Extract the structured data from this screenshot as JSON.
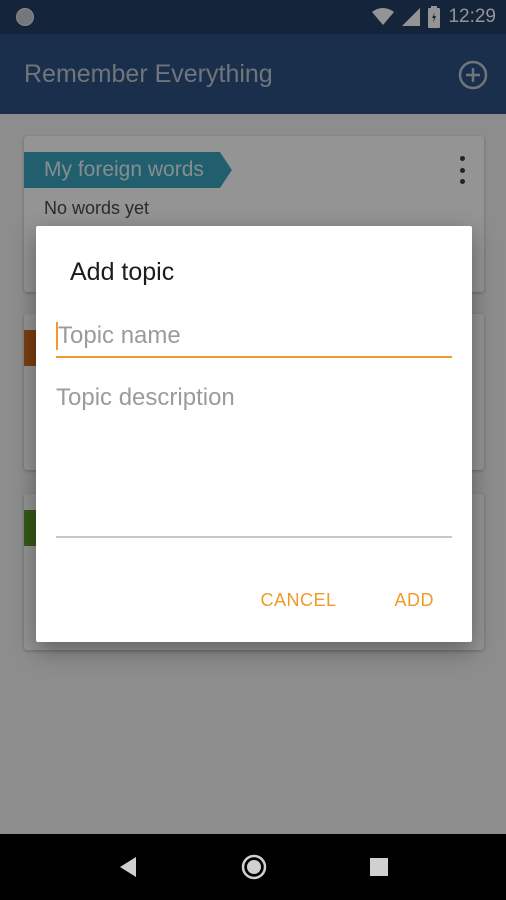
{
  "status_bar": {
    "time": "12:29",
    "icons": [
      "notification-dot-icon",
      "wifi-icon",
      "signal-icon",
      "battery-icon"
    ]
  },
  "app_bar": {
    "title": "Remember Everything",
    "add_icon": "add-circle-icon"
  },
  "cards": [
    {
      "tag": "My foreign words",
      "subtitle": "No words yet",
      "tag_color": "#3aa4bf"
    },
    {
      "tag": "",
      "subtitle": "",
      "tag_color": "#d2691e"
    },
    {
      "tag": "",
      "subtitle": "",
      "tag_color": "#5a9a2a"
    }
  ],
  "dialog": {
    "title": "Add topic",
    "topic_name_placeholder": "Topic name",
    "topic_name_value": "",
    "topic_description_placeholder": "Topic description",
    "topic_description_value": "",
    "cancel_label": "CANCEL",
    "add_label": "ADD"
  },
  "nav_bar": {
    "icons": [
      "back-icon",
      "home-icon",
      "recents-icon"
    ]
  },
  "colors": {
    "status_bar": "#223e66",
    "app_bar": "#2e5183",
    "accent": "#f19a2a"
  }
}
